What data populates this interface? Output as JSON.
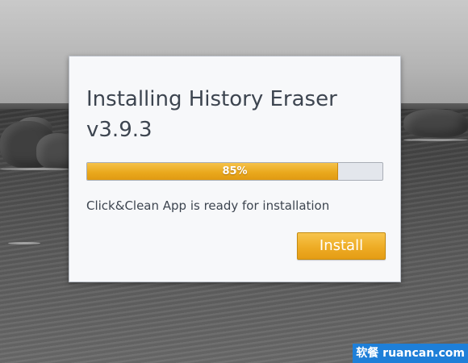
{
  "dialog": {
    "title": "Installing History Eraser v3.9.3",
    "progress": {
      "percent": 85,
      "label": "85%"
    },
    "status_message": "Click&Clean App is ready for installation",
    "install_button_label": "Install"
  },
  "watermark": {
    "text": "软餐 ruancan.com"
  },
  "colors": {
    "accent": "#eeac25",
    "progress_track": "#e3e6ec",
    "dialog_background": "#f7f8fa",
    "text": "#3d4550",
    "watermark_background": "#1e7fd8"
  }
}
